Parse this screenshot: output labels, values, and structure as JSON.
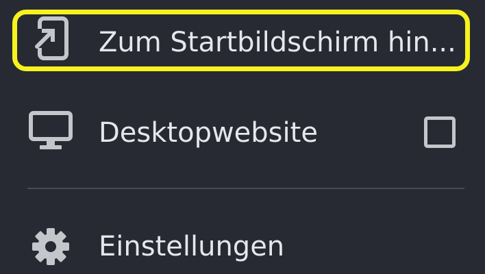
{
  "menu": {
    "items": [
      {
        "label": "Zum Startbildschirm hin...",
        "icon": "add-to-home-screen-icon"
      },
      {
        "label": "Desktopwebsite",
        "icon": "desktop-icon",
        "checked": false
      },
      {
        "label": "Einstellungen",
        "icon": "gear-icon"
      }
    ]
  },
  "colors": {
    "background": "#282a33",
    "text": "#e6e7ec",
    "icon": "#c4c6cc",
    "highlight": "#f7f21e",
    "divider": "#484b55"
  }
}
